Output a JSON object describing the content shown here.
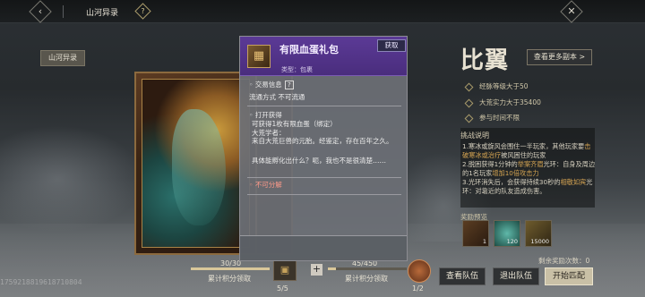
{
  "topbar": {
    "title": "山河异录",
    "back_icon": "back-icon",
    "help_icon": "help-icon",
    "close_icon": "close-icon"
  },
  "map_tag": "山河异录",
  "boss": {
    "name": "比翼",
    "more_button": "查看更多副本 >",
    "requirements": [
      "经脉等级大于50",
      "大荒实力大于35400",
      "参与时间不限"
    ]
  },
  "rules": {
    "title": "挑战说明",
    "lines": [
      {
        "prefix": "1.寒冰或旋风会围住一半玩家，其他玩家要",
        "highlight": "击破寒冰或治疗",
        "suffix": "被风困住的玩家"
      },
      {
        "prefix": "2.脱困获得1分钟的",
        "highlight": "举案齐眉",
        "suffix": "光环：自身及周边的1名玩家",
        "highlight2": "增加10倍攻击力"
      },
      {
        "prefix": "3.光环消失后，会获得持续30秒的",
        "highlight": "相敬如宾",
        "suffix": "光环：对靠近的队友造成伤害。"
      }
    ]
  },
  "rewards": {
    "title": "奖励预览",
    "items": [
      {
        "icon": "chest-icon",
        "quantity": "1"
      },
      {
        "icon": "jade-icon",
        "quantity": "120"
      },
      {
        "icon": "coin-icon",
        "quantity": "15000"
      }
    ],
    "remaining": "剩余奖励次数：0"
  },
  "bottom": {
    "kill_value": "30/30",
    "kill_progress": 1.0,
    "kill_label": "累计积分领取",
    "chest_count": "5/5",
    "score_value": "45/450",
    "score_progress": 0.1,
    "score_label": "累计积分领取",
    "reward_count": "1/2",
    "uid": "1759218819618710804"
  },
  "buttons": {
    "view_team": "查看队伍",
    "leave_team": "退出队伍",
    "start_match": "开始匹配"
  },
  "tooltip": {
    "title": "有限血蛋礼包",
    "get_button": "获取",
    "type": "类型：包裹",
    "trade_info": "交易信息",
    "circulation": "流通方式   不可流通",
    "open_title": "打开获得",
    "open_desc": "可获得1枚有限血蛋（绑定）",
    "lore_1": "大荒学者：",
    "lore_2": "来自大荒巨兽的元胎。经鉴定，存在百年之久。",
    "lore_3": "具体能孵化出什么？呃，我也不是很清楚……",
    "no_split": "不可分解"
  },
  "colors": {
    "accent_gold": "#d5a452",
    "tooltip_purple": "#5b3a96",
    "warning": "#ff9a8a"
  }
}
